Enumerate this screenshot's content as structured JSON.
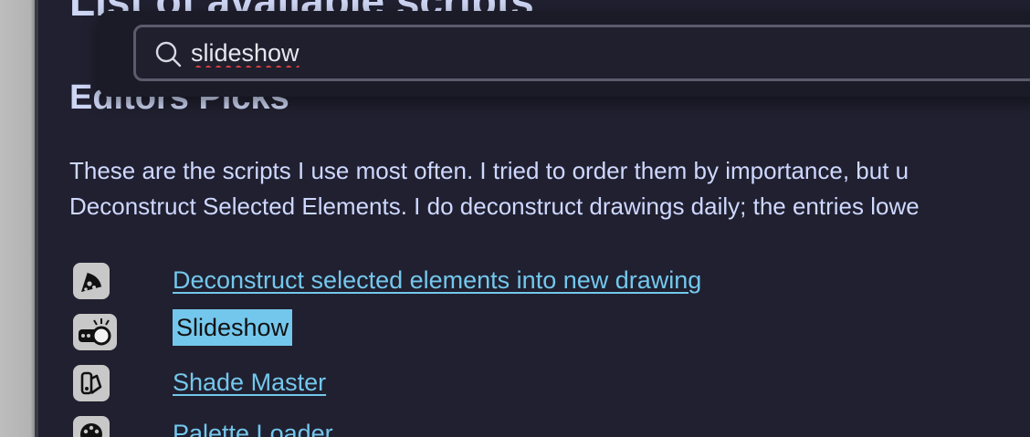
{
  "page": {
    "title": "List of available scripts",
    "section_title": "Editors Picks",
    "paragraph_lines": [
      "These are the scripts I use most often. I tried to order them by importance, but u",
      "Deconstruct Selected Elements. I do deconstruct drawings daily; the entries lowe"
    ]
  },
  "scripts": [
    {
      "label": "Deconstruct selected elements into new drawing",
      "icon": "pizza-slice-icon",
      "highlighted": false
    },
    {
      "label": "Slideshow",
      "icon": "projector-icon",
      "highlighted": true
    },
    {
      "label": "Shade Master",
      "icon": "swatch-icon",
      "highlighted": false
    },
    {
      "label": "Palette Loader",
      "icon": "palette-icon",
      "highlighted": false
    }
  ],
  "search": {
    "value": "slideshow",
    "placeholder": ""
  },
  "colors": {
    "background": "#202030",
    "link": "#74c7ec",
    "text": "#cfd8ff",
    "highlight": "#74c7ec"
  }
}
